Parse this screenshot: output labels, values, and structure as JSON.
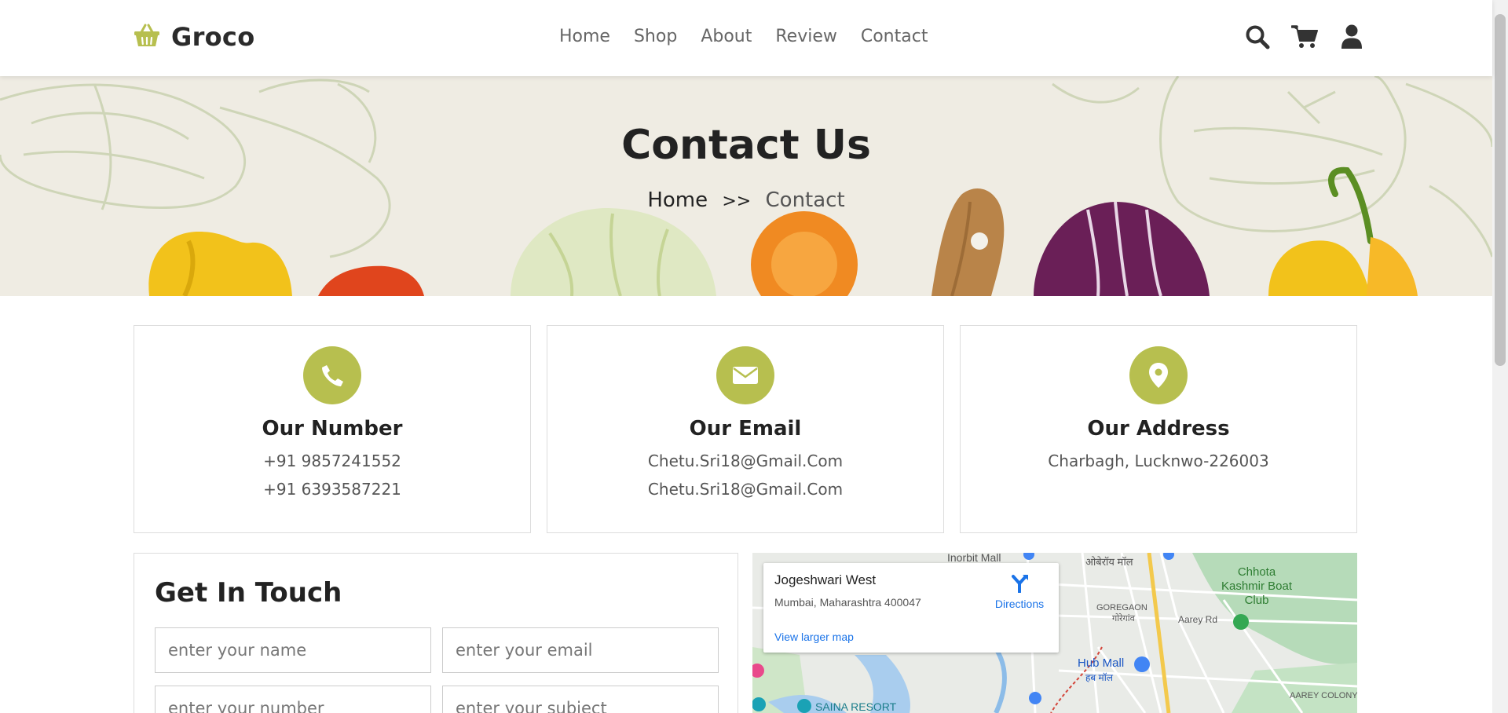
{
  "brand": {
    "name": "Groco",
    "icon": "basket-icon",
    "accent": "#b7bf4f"
  },
  "nav": [
    "Home",
    "Shop",
    "About",
    "Review",
    "Contact"
  ],
  "header_icons": [
    "search-icon",
    "cart-icon",
    "user-icon"
  ],
  "banner": {
    "title": "Contact Us",
    "crumb_home": "Home",
    "crumb_sep": ">>",
    "crumb_current": "Contact"
  },
  "cards": [
    {
      "icon": "phone-icon",
      "title": "Our Number",
      "lines": [
        "+91 9857241552",
        "+91 6393587221"
      ]
    },
    {
      "icon": "envelope-icon",
      "title": "Our Email",
      "lines": [
        "Chetu.Sri18@Gmail.Com",
        "Chetu.Sri18@Gmail.Com"
      ]
    },
    {
      "icon": "map-pin-icon",
      "title": "Our Address",
      "lines": [
        "Charbagh, Lucknwo-226003"
      ]
    }
  ],
  "form": {
    "title": "Get In Touch",
    "placeholders": {
      "name": "enter your name",
      "email": "enter your email",
      "number": "enter your number",
      "subject": "enter your subject"
    }
  },
  "map": {
    "place": "Jogeshwari West",
    "address": "Mumbai, Maharashtra 400047",
    "directions": "Directions",
    "larger": "View larger map",
    "labels": {
      "inorbit": "Inorbit Mall",
      "oberoi_hi": "ओबेरॉय मॉल",
      "goregaon": "GOREGAON",
      "goregaon_hi": "गोरेगांव",
      "aarey_rd": "Aarey Rd",
      "chhota_kashmir": "Chhota Kashmir Boat Club",
      "hub_mall": "Hub Mall",
      "hub_mall_hi": "हब मॉल",
      "saina": "SAINA RESORT",
      "aarey_colony": "AAREY COLONY"
    }
  }
}
